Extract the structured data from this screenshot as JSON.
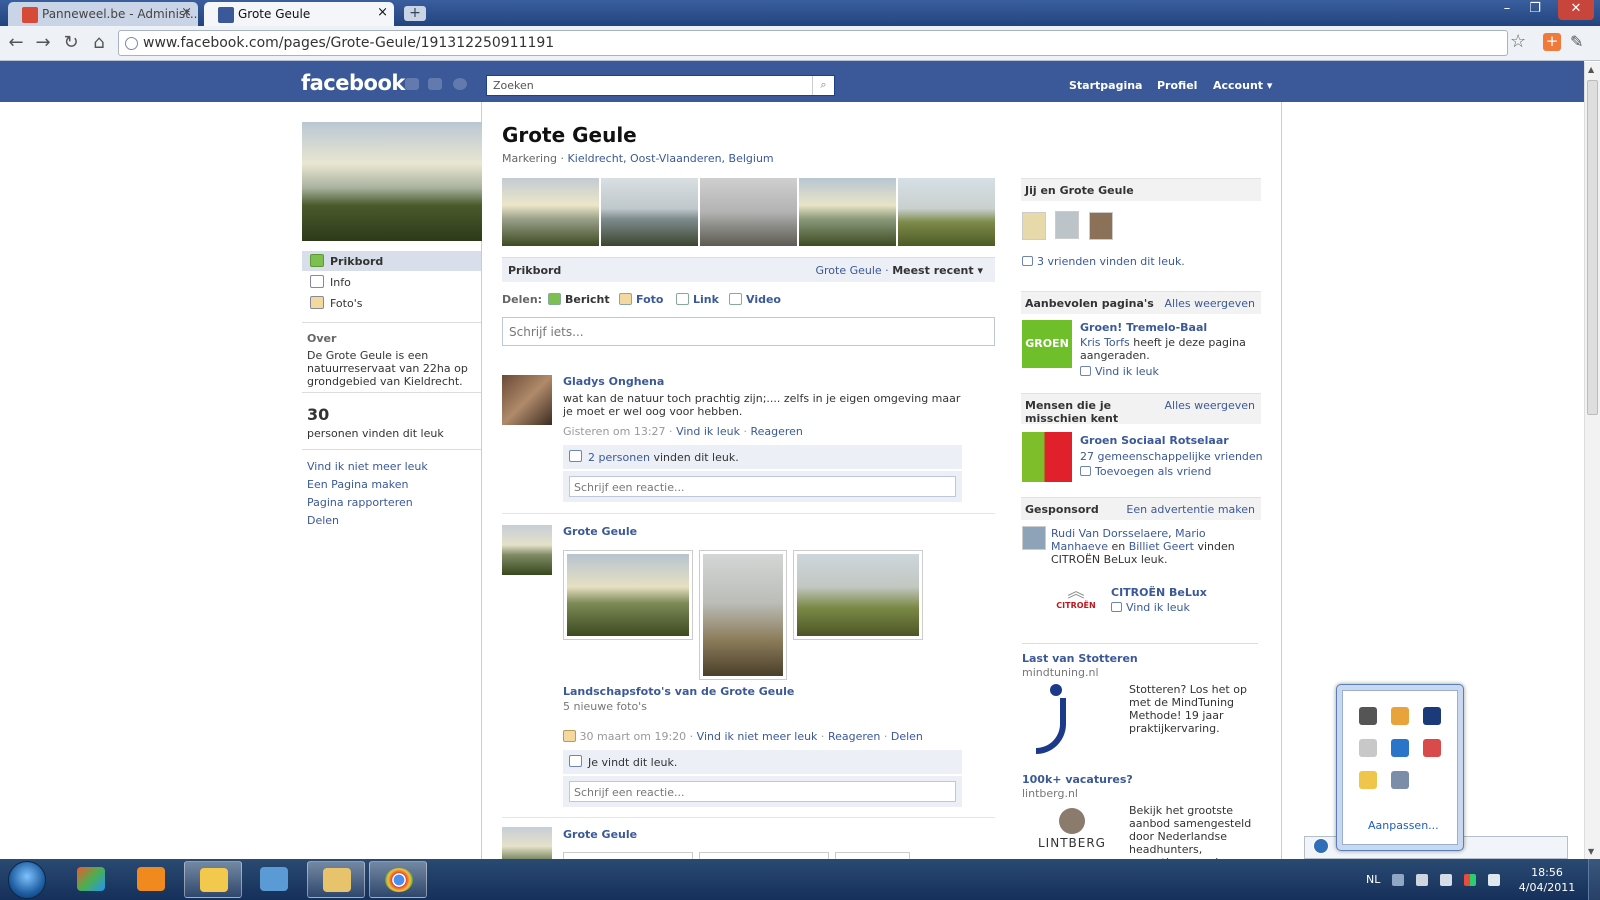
{
  "browser": {
    "tabs": [
      {
        "label": "Panneweel.be - Administ...",
        "active": false
      },
      {
        "label": "Grote Geule",
        "active": true
      }
    ],
    "url": "www.facebook.com/pages/Grote-Geule/191312250911191",
    "window_controls": {
      "minimize": "–",
      "restore": "❐",
      "close": "✕"
    }
  },
  "fb_header": {
    "logo": "facebook",
    "search_placeholder": "Zoeken",
    "nav": {
      "home": "Startpagina",
      "profile": "Profiel",
      "account": "Account ▾"
    }
  },
  "left": {
    "nav": [
      {
        "label": "Prikbord",
        "active": true
      },
      {
        "label": "Info",
        "active": false
      },
      {
        "label": "Foto's",
        "active": false
      }
    ],
    "about_heading": "Over",
    "about_text": "De Grote Geule is een natuurreservaat van 22ha op grondgebied van Kieldrecht.",
    "likes_count": "30",
    "likes_label": "personen vinden dit leuk",
    "links": [
      "Vind ik niet meer leuk",
      "Een Pagina maken",
      "Pagina rapporteren",
      "Delen"
    ]
  },
  "main": {
    "title": "Grote Geule",
    "subtitle_cat": "Markering",
    "subtitle_loc": "Kieldrecht, Oost-Vlaanderen, Belgium",
    "wall_tab": "Prikbord",
    "wall_filter_name": "Grote Geule",
    "wall_filter_sort": "Meest recent ▾",
    "share_label": "Delen:",
    "share_options": [
      "Bericht",
      "Foto",
      "Link",
      "Video"
    ],
    "composer_placeholder": "Schrijf iets...",
    "posts": [
      {
        "author": "Gladys Onghena",
        "text": "wat kan de natuur toch prachtig zijn;.... zelfs in je eigen omgeving maar je moet er wel oog voor hebben.",
        "time": "Gisteren om 13:27",
        "actions": [
          "Vind ik leuk",
          "Reageren"
        ],
        "likes_link": "2 personen",
        "likes_text": " vinden dit leuk.",
        "comment_placeholder": "Schrijf een reactie..."
      },
      {
        "author": "Grote Geule",
        "album_title": "Landschapsfoto's van de Grote Geule",
        "album_sub": "5 nieuwe foto's",
        "time": "30 maart om 19:20",
        "actions": [
          "Vind ik niet meer leuk",
          "Reageren",
          "Delen"
        ],
        "likes_text": "Je vindt dit leuk.",
        "comment_placeholder": "Schrijf een reactie..."
      },
      {
        "author": "Grote Geule"
      }
    ]
  },
  "right": {
    "you_and": {
      "heading": "Jij en Grote Geule",
      "friends_like": "3 vrienden vinden dit leuk."
    },
    "recommended": {
      "heading": "Aanbevolen pagina's",
      "see_all": "Alles weergeven",
      "page_name": "Groen! Tremelo-Baal",
      "by": "Kris Torfs",
      "by_text": " heeft je deze pagina aangeraden.",
      "like": "Vind ik leuk",
      "logo_text": "GROEN"
    },
    "people": {
      "heading": "Mensen die je misschien kent",
      "see_all": "Alles weergeven",
      "name": "Groen Sociaal Rotselaar",
      "mutual": "27 gemeenschappelijke vrienden",
      "add": "Toevoegen als vriend"
    },
    "sponsored": {
      "heading": "Gesponsord",
      "create": "Een advertentie maken",
      "names": [
        "Rudi Van Dorsselaere",
        "Mario Manhaeve",
        "Billiet Geert"
      ],
      "text_1": ", ",
      "text_2": " en ",
      "text_3": " vinden CITROËN BeLux leuk.",
      "brand": "CITROËN BeLux",
      "brand_like": "Vind ik leuk",
      "brand_logo_text": "CITROËN"
    },
    "ads": [
      {
        "title": "Last van Stotteren",
        "domain": "mindtuning.nl",
        "body": "Stotteren? Los het op met de MindTuning Methode! 19 jaar praktijkervaring."
      },
      {
        "title": "100k+ vacatures?",
        "domain": "lintberg.nl",
        "body": "Bekijk het grootste aanbod samengesteld door Nederlandse headhunters, executive search bureaus en",
        "logo_text": "LINTBERG"
      }
    ]
  },
  "tray_flyout": {
    "customize": "Aanpassen..."
  },
  "taskbar": {
    "lang": "NL",
    "time": "18:56",
    "date": "4/04/2011"
  }
}
